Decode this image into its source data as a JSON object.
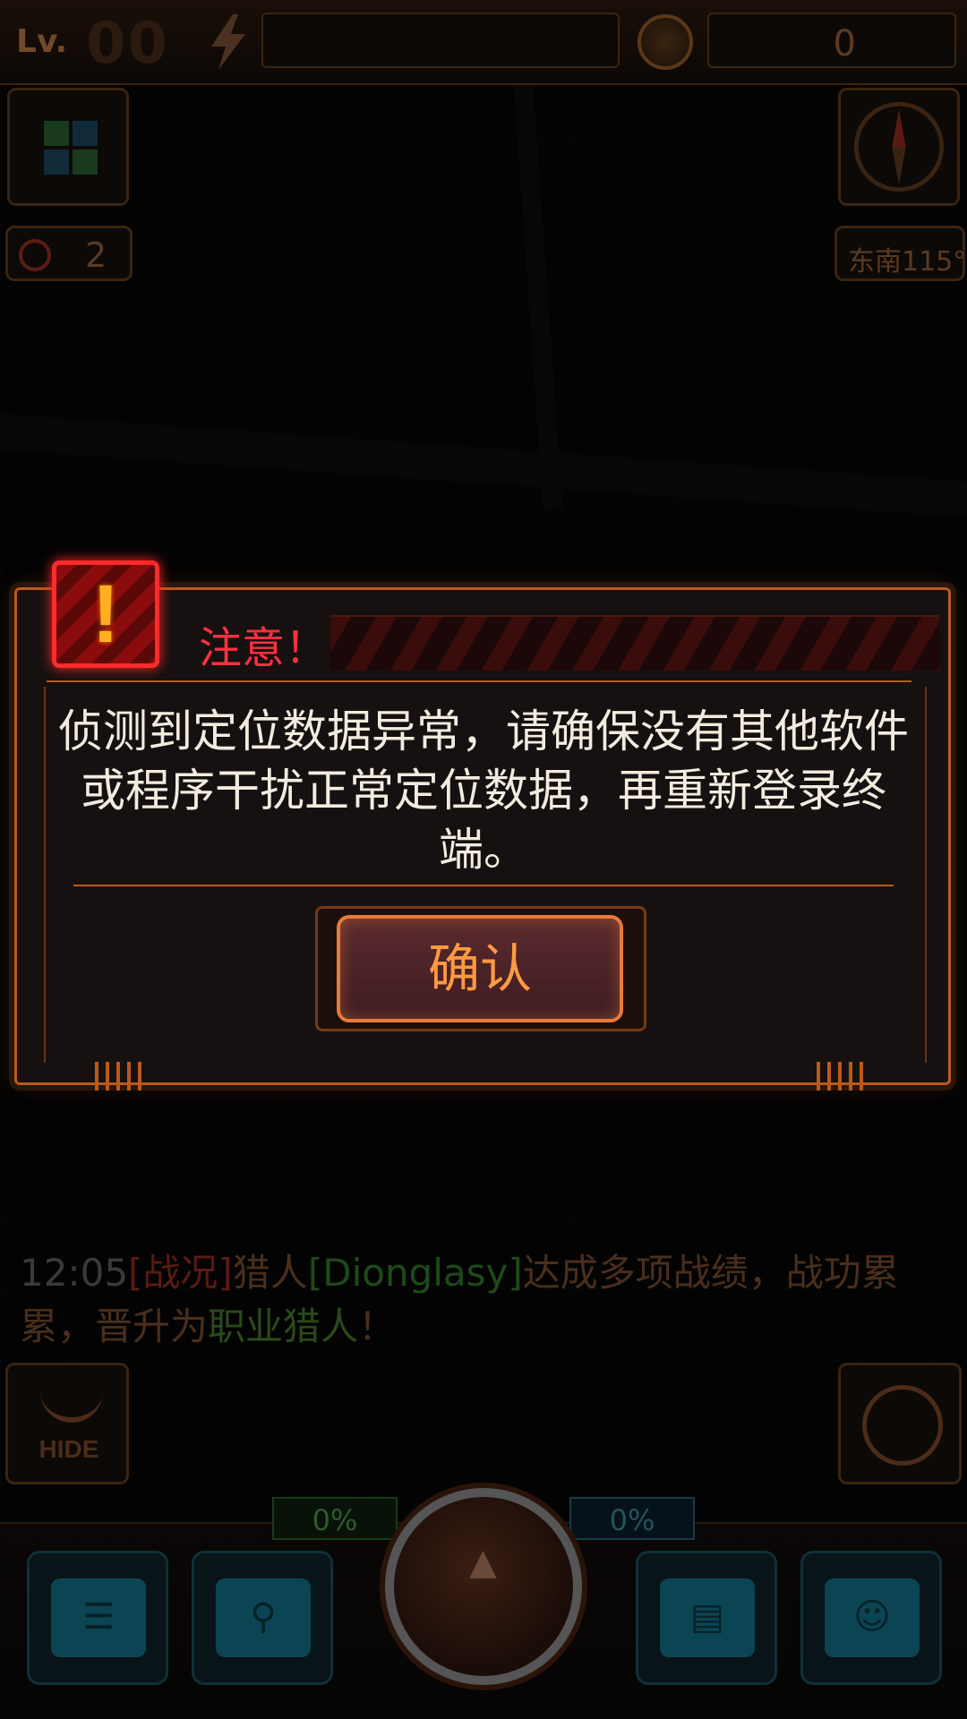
{
  "topbar": {
    "level_label": "Lv.",
    "level_value": "00",
    "coin_value": "0"
  },
  "side": {
    "hp_value": "2",
    "direction": "东南115°"
  },
  "dialog": {
    "title": "注意！",
    "alert_glyph": "!",
    "message": "侦测到定位数据异常，请确保没有其他软件或程序干扰正常定位数据，再重新登录终端。",
    "confirm_label": "确认"
  },
  "chat": {
    "time": "12:05",
    "tag": "[战况]",
    "prefix": "猎人",
    "name": "[Dionglasy]",
    "middle": "达成多项战绩，战功累累，晋升为",
    "rank": "职业猎人",
    "suffix": "！"
  },
  "bottom": {
    "hide_label": "HIDE",
    "left_percent": "0%",
    "right_percent": "0%"
  },
  "colors": {
    "accent": "#d97a2e",
    "alert_red": "#ff2a2a",
    "dialog_title": "#ff3040",
    "confirm_text": "#ff9a40",
    "nav_teal": "#0b4452"
  },
  "icons": [
    "energy-icon",
    "coin-icon",
    "grid-icon",
    "compass-icon",
    "hp-icon",
    "alert-icon",
    "radar-icon",
    "chat-icon",
    "route-icon",
    "terminal-icon",
    "profile-icon"
  ]
}
